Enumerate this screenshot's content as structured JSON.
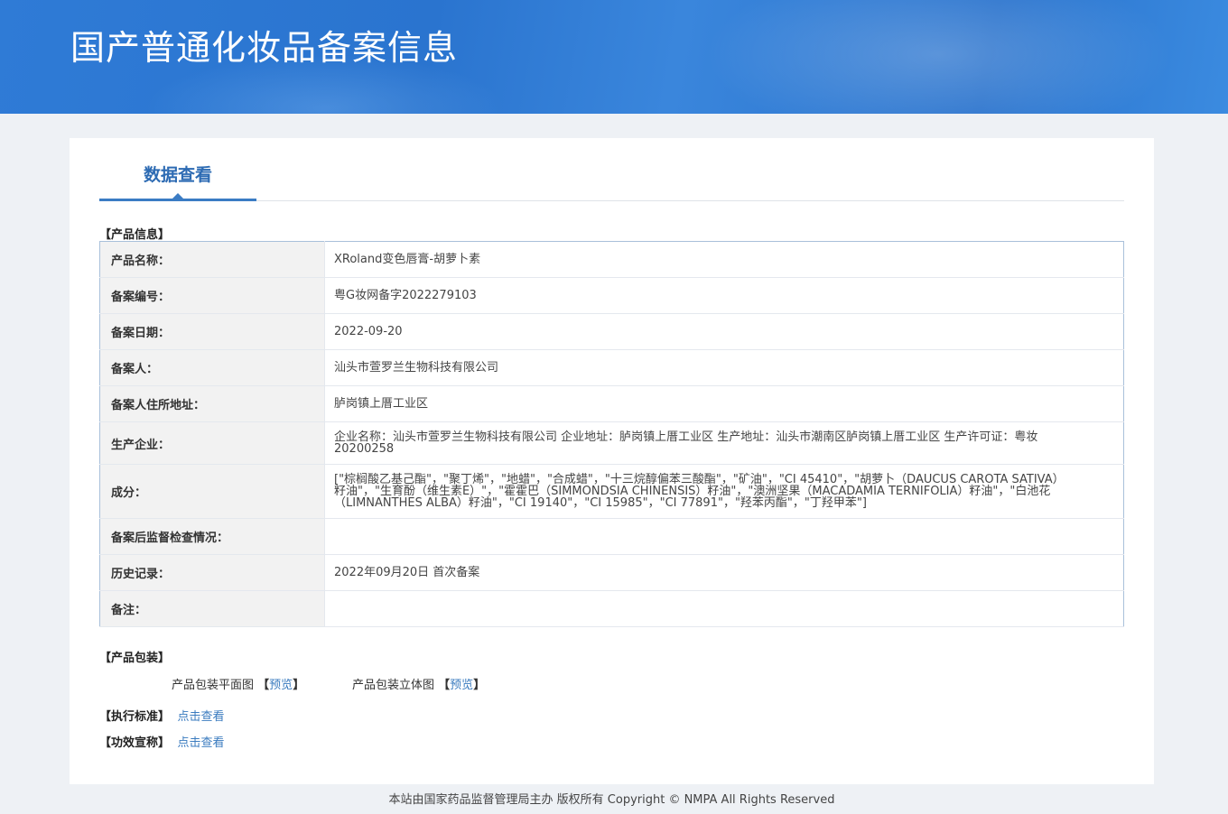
{
  "header": {
    "title": "国产普通化妆品备案信息"
  },
  "tab": {
    "title": "数据查看"
  },
  "sections": {
    "product_info": "【产品信息】",
    "packaging": "【产品包装】",
    "standard": "【执行标准】",
    "efficacy": "【功效宣称】"
  },
  "product_rows": [
    {
      "key": "产品名称：",
      "value": "XRoland变色唇膏-胡萝卜素"
    },
    {
      "key": "备案编号：",
      "value": "粤G妆网备字2022279103"
    },
    {
      "key": "备案日期：",
      "value": "2022-09-20"
    },
    {
      "key": "备案人：",
      "value": "汕头市萱罗兰生物科技有限公司"
    },
    {
      "key": "备案人住所地址：",
      "value": "胪岗镇上厝工业区"
    },
    {
      "key": "生产企业：",
      "value": "企业名称：汕头市萱罗兰生物科技有限公司 企业地址：胪岗镇上厝工业区 生产地址：汕头市潮南区胪岗镇上厝工业区 生产许可证：粤妆20200258"
    },
    {
      "key": "成分：",
      "value": "[\"棕榈酸乙基己酯\"，\"聚丁烯\"，\"地蜡\"，\"合成蜡\"，\"十三烷醇偏苯三酸酯\"，\"矿油\"，\"CI 45410\"，\"胡萝卜（DAUCUS CAROTA SATIVA）籽油\"，\"生育酚（维生素E）\"，\"霍霍巴（SIMMONDSIA CHINENSIS）籽油\"，\"澳洲坚果（MACADAMIA TERNIFOLIA）籽油\"，\"白池花（LIMNANTHES ALBA）籽油\"，\"CI 19140\"，\"CI 15985\"，\"CI 77891\"，\"羟苯丙酯\"，\"丁羟甲苯\"]"
    },
    {
      "key": "备案后监督检查情况：",
      "value": ""
    },
    {
      "key": "历史记录：",
      "value": "2022年09月20日 首次备案"
    },
    {
      "key": "备注：",
      "value": ""
    }
  ],
  "packaging": {
    "flat_label": "产品包装平面图",
    "stereo_label": "产品包装立体图",
    "preview": "预览",
    "bracket_open": "【",
    "bracket_close": "】"
  },
  "standard_link": "点击查看",
  "efficacy_link": "点击查看",
  "footer": {
    "text": "本站由国家药品监督管理局主办 版权所有 Copyright © NMPA All Rights Reserved"
  }
}
